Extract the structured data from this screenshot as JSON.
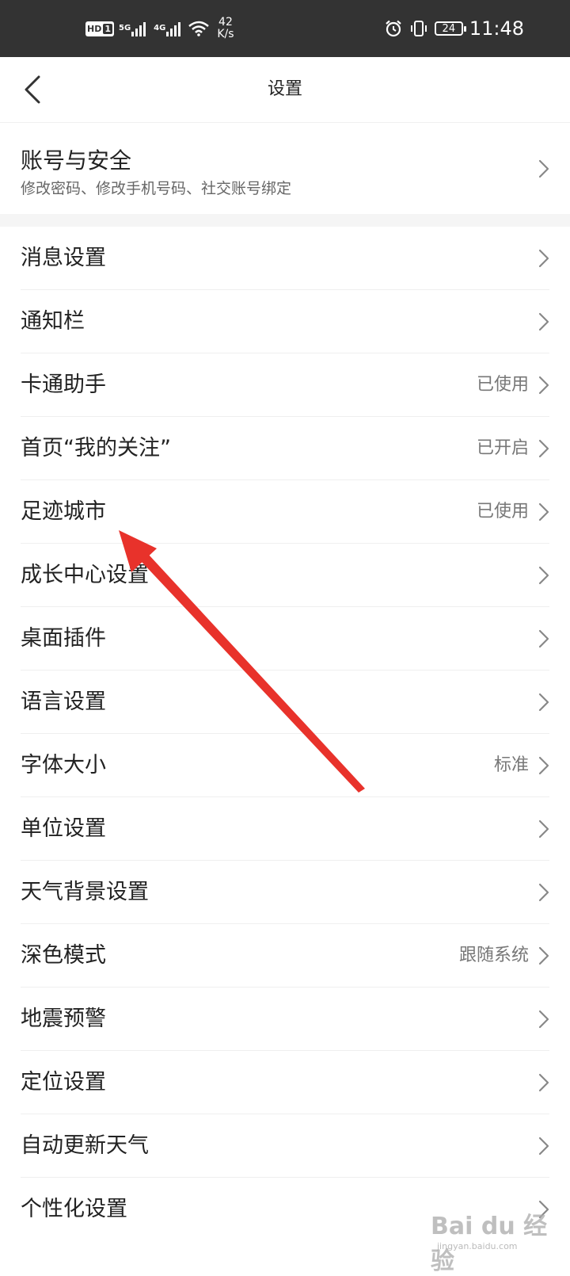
{
  "status_bar": {
    "hd": "HD",
    "hd_slot": "1",
    "net1": "5G",
    "net2": "4G",
    "speed_value": "42",
    "speed_unit": "K/s",
    "battery": "24",
    "time": "11:48"
  },
  "header": {
    "title": "设置"
  },
  "account": {
    "title": "账号与安全",
    "description": "修改密码、修改手机号码、社交账号绑定"
  },
  "settings": [
    {
      "label": "消息设置",
      "value": ""
    },
    {
      "label": "通知栏",
      "value": ""
    },
    {
      "label": "卡通助手",
      "value": "已使用"
    },
    {
      "label": "首页“我的关注”",
      "value": "已开启"
    },
    {
      "label": "足迹城市",
      "value": "已使用"
    },
    {
      "label": "成长中心设置",
      "value": ""
    },
    {
      "label": "桌面插件",
      "value": ""
    },
    {
      "label": "语言设置",
      "value": ""
    },
    {
      "label": "字体大小",
      "value": "标准"
    },
    {
      "label": "单位设置",
      "value": ""
    },
    {
      "label": "天气背景设置",
      "value": ""
    },
    {
      "label": "深色模式",
      "value": "跟随系统"
    },
    {
      "label": "地震预警",
      "value": ""
    },
    {
      "label": "定位设置",
      "value": ""
    },
    {
      "label": "自动更新天气",
      "value": ""
    },
    {
      "label": "个性化设置",
      "value": ""
    }
  ],
  "watermark": {
    "brand": "Bai du 经验",
    "url": "jingyan.baidu.com"
  },
  "colors": {
    "status_bar_bg": "#333333",
    "annotation_arrow": "#e8322b",
    "section_gap": "#f5f5f5"
  },
  "icons": {
    "back": "chevron-left-icon",
    "row": "chevron-right-icon",
    "alarm": "alarm-clock-icon",
    "vibrate": "vibrate-icon",
    "wifi": "wifi-icon"
  }
}
